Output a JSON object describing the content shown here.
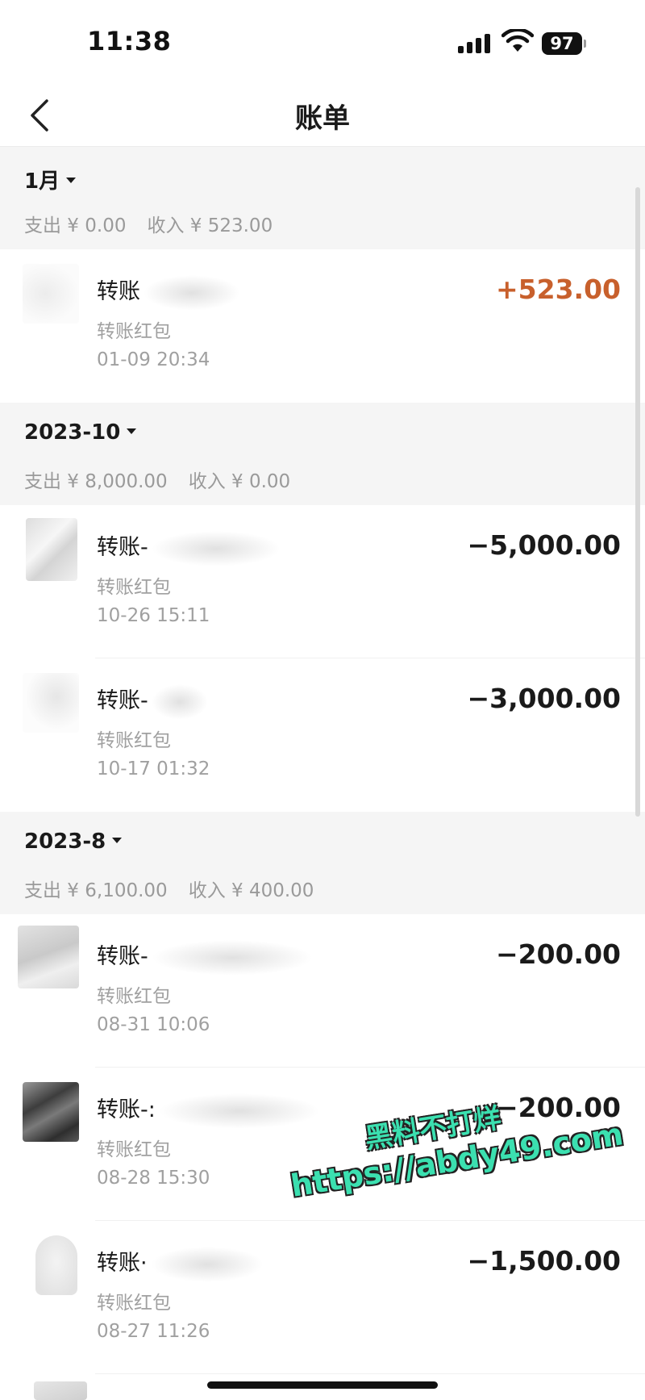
{
  "status_bar": {
    "time": "11:38",
    "battery": "97"
  },
  "nav": {
    "title": "账单"
  },
  "months": [
    {
      "label": "1月",
      "expense": "支出 ¥ 0.00",
      "income": "收入 ¥ 523.00"
    },
    {
      "label": "2023-10",
      "expense": "支出 ¥ 8,000.00",
      "income": "收入 ¥ 0.00"
    },
    {
      "label": "2023-8",
      "expense": "支出 ¥ 6,100.00",
      "income": "收入 ¥ 400.00"
    }
  ],
  "transactions": [
    {
      "title": "转账",
      "subtitle": "转账红包",
      "time": "01-09  20:34",
      "amount": "+523.00"
    },
    {
      "title": "转账-",
      "subtitle": "转账红包",
      "time": "10-26  15:11",
      "amount": "−5,000.00"
    },
    {
      "title": "转账-",
      "subtitle": "转账红包",
      "time": "10-17  01:32",
      "amount": "−3,000.00"
    },
    {
      "title": "转账-",
      "subtitle": "转账红包",
      "time": "08-31  10:06",
      "amount": "−200.00"
    },
    {
      "title": "转账-:",
      "subtitle": "转账红包",
      "time": "08-28  15:30",
      "amount": "−200.00"
    },
    {
      "title": "转账·",
      "subtitle": "转账红包",
      "time": "08-27  11:26",
      "amount": "−1,500.00"
    }
  ],
  "watermark": {
    "line1": "黑料不打烊",
    "line2": "https://abdy49.com"
  },
  "colors": {
    "income": "#c8602c",
    "header_bg": "#f5f5f5",
    "secondary_text": "#a0a0a0"
  }
}
